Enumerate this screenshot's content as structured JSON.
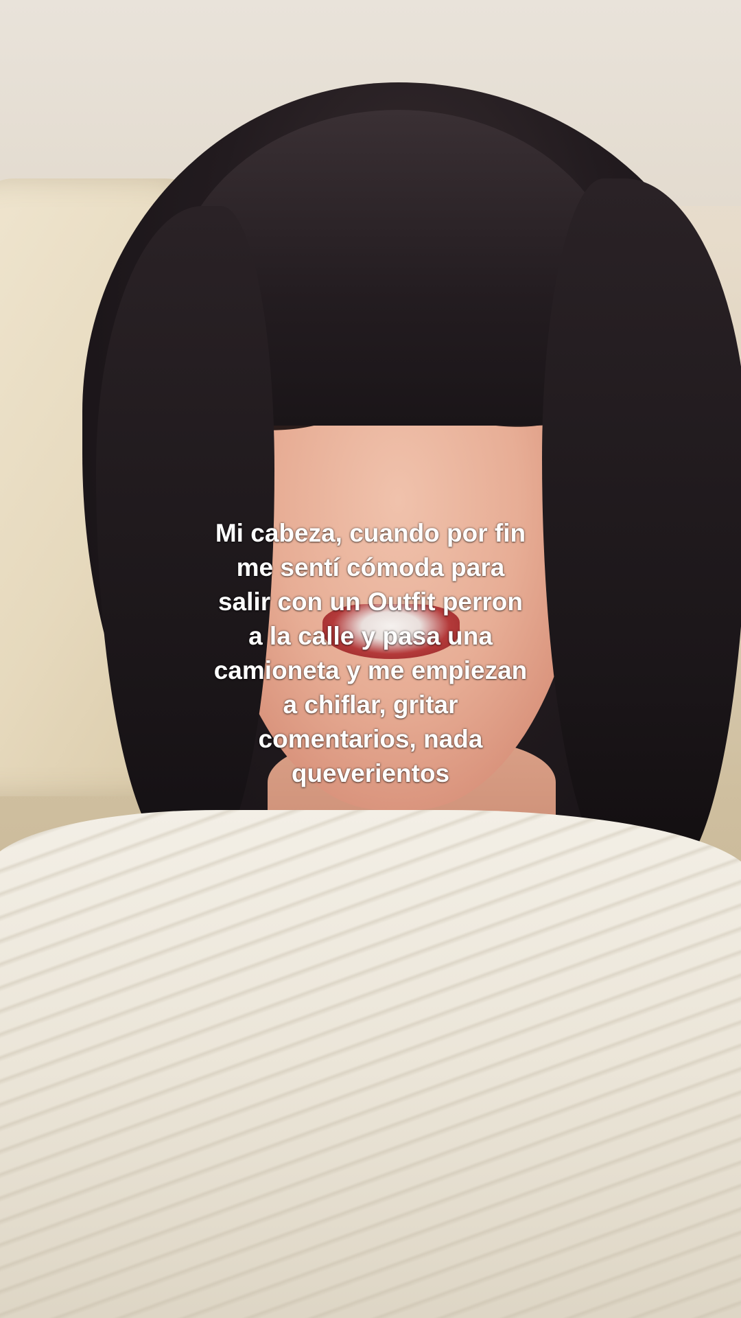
{
  "caption": {
    "lines": [
      "Mi cabeza, cuando por fin",
      "me sentí cómoda para",
      "salir con un Outfit perron",
      "a la calle y pasa una",
      "camioneta y me empiezan",
      "a chiflar, gritar",
      "comentarios, nada",
      "queverientos"
    ]
  }
}
